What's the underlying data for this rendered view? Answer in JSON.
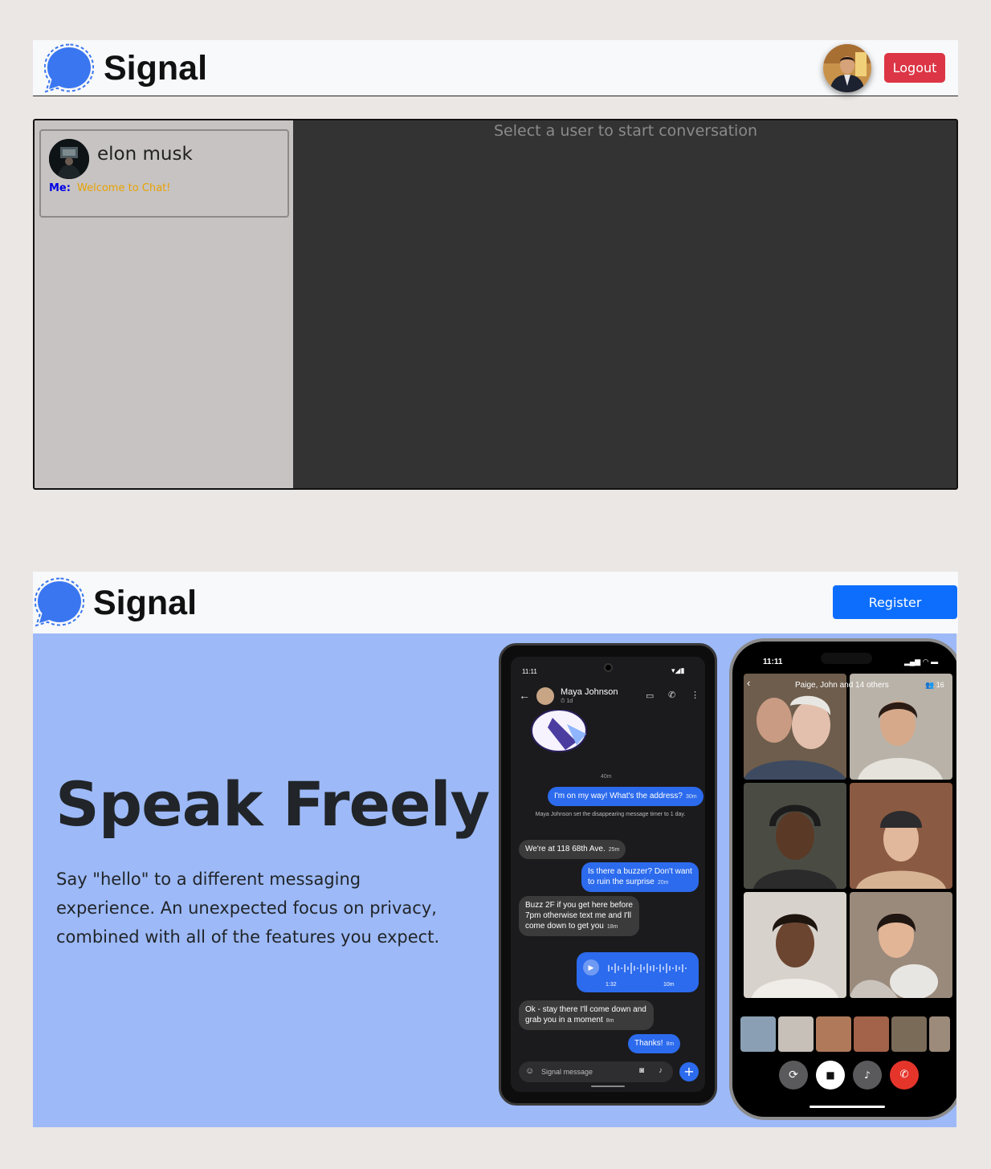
{
  "app": {
    "brand": "Signal"
  },
  "header": {
    "logout_label": "Logout"
  },
  "sidebar": {
    "conversations": [
      {
        "name": "elon musk",
        "sender_label": "Me:",
        "last_message": "Welcome to Chat!"
      }
    ]
  },
  "chat": {
    "placeholder": "Select a user to start conversation"
  },
  "landing": {
    "brand": "Signal",
    "register_label": "Register",
    "title": "Speak Freely",
    "subtitle": "Say \"hello\" to a different messaging experience. An unexpected focus on privacy, combined with all of the features you expect."
  },
  "android_mock": {
    "time": "11:11",
    "contact": "Maya Johnson",
    "timer": "1d",
    "divider": "40m",
    "messages": [
      {
        "text": "I'm on my way! What's the address?",
        "meta": "30m",
        "direction": "out"
      },
      {
        "text": "Maya Johnson set the disappearing message timer to 1 day.",
        "direction": "system"
      },
      {
        "text": "We're at 118 68th Ave.",
        "meta": "25m",
        "direction": "in"
      },
      {
        "text": "Is there a buzzer? Don't want to ruin the surprise",
        "meta": "20m",
        "direction": "out"
      },
      {
        "text": "Buzz 2F if you get here before 7pm otherwise text me and I'll come down to get you",
        "meta": "18m",
        "direction": "in"
      },
      {
        "text": "1:32",
        "meta": "10m",
        "direction": "out-voice"
      },
      {
        "text": "Ok - stay there I'll come down and grab you in a moment",
        "meta": "8m",
        "direction": "in"
      },
      {
        "text": "Thanks!",
        "meta": "8m",
        "direction": "out"
      }
    ],
    "composer_placeholder": "Signal message"
  },
  "iphone_mock": {
    "time": "11:11",
    "call_title": "Paige, John and 14 others",
    "participant_count": "16"
  },
  "colors": {
    "header_bg": "#f8f9fa",
    "logout": "#dc3545",
    "register": "#0d6efd",
    "signal_blue": "#3a76f0",
    "sidebar_bg": "#c7c3c2",
    "chat_bg": "#333333",
    "hero_bg": "#9db9f7",
    "me_label": "#0000e6",
    "last_message": "#e8a200"
  }
}
